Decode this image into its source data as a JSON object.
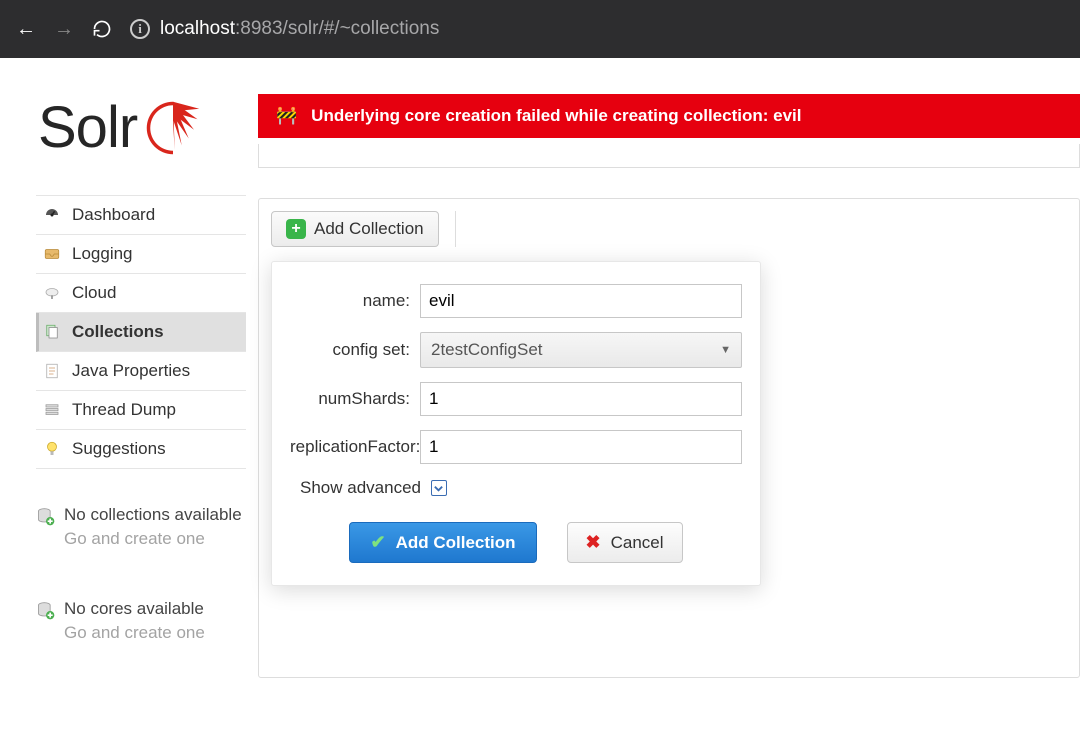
{
  "browser": {
    "url_host": "localhost",
    "url_rest": ":8983/solr/#/~collections"
  },
  "logo": {
    "text": "Solr"
  },
  "error": {
    "message": "Underlying core creation failed while creating collection: evil"
  },
  "nav": {
    "items": [
      {
        "label": "Dashboard"
      },
      {
        "label": "Logging"
      },
      {
        "label": "Cloud"
      },
      {
        "label": "Collections"
      },
      {
        "label": "Java Properties"
      },
      {
        "label": "Thread Dump"
      },
      {
        "label": "Suggestions"
      }
    ]
  },
  "stubs": {
    "collections": {
      "line1": "No collections available",
      "line2": "Go and create one"
    },
    "cores": {
      "line1": "No cores available",
      "line2": "Go and create one"
    }
  },
  "toolbar": {
    "add_collection": "Add Collection"
  },
  "form": {
    "labels": {
      "name": "name:",
      "configset": "config set:",
      "numShards": "numShards:",
      "replicationFactor": "replicationFactor:"
    },
    "values": {
      "name": "evil",
      "configset": "2testConfigSet",
      "numShards": "1",
      "replicationFactor": "1"
    },
    "advanced_label": "Show advanced",
    "submit": "Add Collection",
    "cancel": "Cancel"
  }
}
